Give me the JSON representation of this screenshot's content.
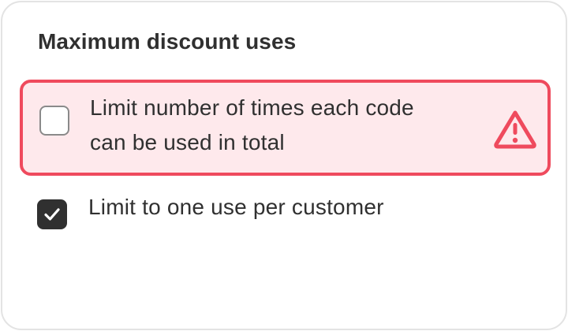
{
  "section": {
    "title": "Maximum discount uses"
  },
  "options": [
    {
      "label": "Limit number of times each code can be used in total",
      "checked": false,
      "state": "error",
      "icon": "warning-icon"
    },
    {
      "label": "Limit to one use per customer",
      "checked": true,
      "state": "normal"
    }
  ],
  "colors": {
    "error_border": "#ef4a5d",
    "error_background": "#fee9ec",
    "checked_fill": "#303030",
    "text": "#303030"
  }
}
